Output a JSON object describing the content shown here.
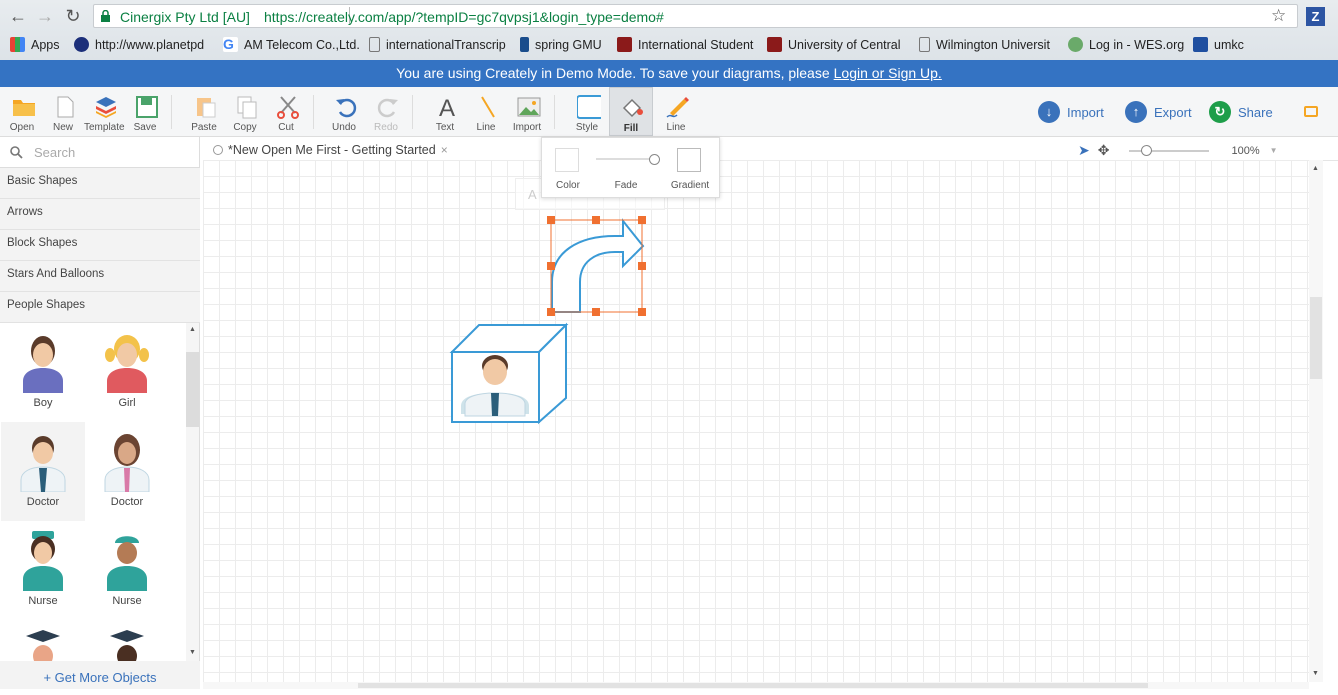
{
  "browser": {
    "site_identity": "Cinergix Pty Ltd [AU]",
    "url": "https://creately.com/app/?tempID=gc7qvpsj1&login_type=demo#",
    "extension_label": "Z",
    "bookmarks": [
      {
        "label": "Apps"
      },
      {
        "label": "http://www.planetpd"
      },
      {
        "label": "AM Telecom Co.,Ltd."
      },
      {
        "label": "internationalTranscrip"
      },
      {
        "label": "spring GMU"
      },
      {
        "label": "International Student"
      },
      {
        "label": "University of Central"
      },
      {
        "label": "Wilmington Universit"
      },
      {
        "label": "Log in - WES.org"
      },
      {
        "label": "umkc"
      }
    ]
  },
  "banner": {
    "text": "You are using Creately in Demo Mode. To save your diagrams, please",
    "link": "Login or Sign Up."
  },
  "toolbar": {
    "items": [
      {
        "label": "Open"
      },
      {
        "label": "New"
      },
      {
        "label": "Template"
      },
      {
        "label": "Save"
      },
      {
        "label": "Paste"
      },
      {
        "label": "Copy"
      },
      {
        "label": "Cut"
      },
      {
        "label": "Undo"
      },
      {
        "label": "Redo"
      },
      {
        "label": "Text"
      },
      {
        "label": "Line"
      },
      {
        "label": "Import"
      },
      {
        "label": "Style"
      },
      {
        "label": "Fill"
      },
      {
        "label": "Line"
      }
    ],
    "import_btn": "Import",
    "export_btn": "Export",
    "share_btn": "Share"
  },
  "fill_popup": {
    "color": "Color",
    "fade": "Fade",
    "gradient": "Gradient"
  },
  "sidebar": {
    "search_placeholder": "Search",
    "categories": [
      {
        "label": "Basic Shapes"
      },
      {
        "label": "Arrows"
      },
      {
        "label": "Block Shapes"
      },
      {
        "label": "Stars And Balloons"
      },
      {
        "label": "People Shapes"
      }
    ],
    "shapes": [
      {
        "label": "Boy"
      },
      {
        "label": "Girl"
      },
      {
        "label": "Doctor"
      },
      {
        "label": "Doctor"
      },
      {
        "label": "Nurse"
      },
      {
        "label": "Nurse"
      }
    ],
    "get_more": "+ Get More Objects"
  },
  "document": {
    "tab_title": "*New Open Me First - Getting Started",
    "zoom": "100%"
  },
  "colors": {
    "banner": "#3473c3",
    "accent_blue": "#3a72bb",
    "share_green": "#1e9e4a",
    "selection": "#f07030",
    "shape_stroke": "#3a9ad6"
  }
}
